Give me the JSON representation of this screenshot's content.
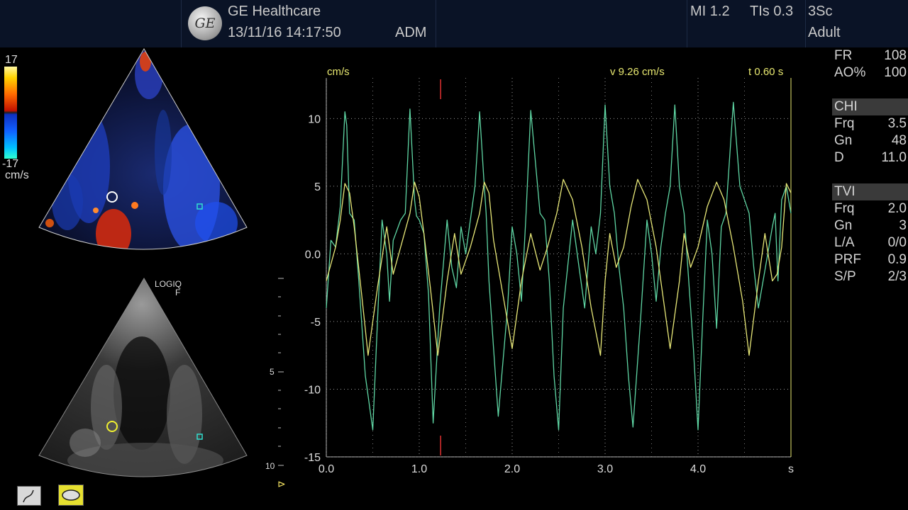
{
  "header": {
    "brand": "GE Healthcare",
    "datetime": "13/11/16 14:17:50",
    "operator": "ADM",
    "mi": "MI 1.2",
    "tis": "TIs 0.3",
    "probe": "3Sc",
    "preset": "Adult",
    "logo_icon": "ge-logo-icon"
  },
  "color_scale": {
    "max": "17",
    "min": "-17",
    "unit": "cm/s"
  },
  "bmode": {
    "device": "LOGIQ",
    "mark": "F",
    "depth_labels": [
      "5",
      "10"
    ]
  },
  "right_panel": {
    "fr": {
      "label": "FR",
      "value": "108"
    },
    "ao": {
      "label": "AO%",
      "value": "100"
    },
    "chi": {
      "title": "CHI",
      "items": [
        {
          "label": "Frq",
          "value": "3.5"
        },
        {
          "label": "Gn",
          "value": "48"
        },
        {
          "label": "D",
          "value": "11.0"
        }
      ]
    },
    "tvi": {
      "title": "TVI",
      "items": [
        {
          "label": "Frq",
          "value": "2.0"
        },
        {
          "label": "Gn",
          "value": "3"
        },
        {
          "label": "L/A",
          "value": "0/0"
        },
        {
          "label": "PRF",
          "value": "0.9"
        },
        {
          "label": "S/P",
          "value": "2/3"
        }
      ]
    }
  },
  "trace": {
    "unit_label": "cm/s",
    "velocity_readout": "v 9.26 cm/s",
    "time_readout": "t 0.60 s",
    "x_unit": "s",
    "cursor_time": 1.23
  },
  "chart_data": {
    "type": "line",
    "xlabel": "s",
    "ylabel": "cm/s",
    "xlim": [
      0,
      5.0
    ],
    "ylim": [
      -15,
      13
    ],
    "x_ticks": [
      "0.0",
      "1.0",
      "2.0",
      "3.0",
      "4.0"
    ],
    "y_ticks": [
      "10",
      "5",
      "0.0",
      "-5",
      "-10",
      "-15"
    ],
    "grid": true,
    "series": [
      {
        "color": "#5fd6a4",
        "x": [
          0,
          0.05,
          0.1,
          0.15,
          0.2,
          0.22,
          0.25,
          0.3,
          0.35,
          0.42,
          0.5,
          0.55,
          0.6,
          0.65,
          0.68,
          0.72,
          0.8,
          0.85,
          0.9,
          0.95,
          0.97,
          1.0,
          1.05,
          1.1,
          1.15,
          1.22,
          1.3,
          1.35,
          1.4,
          1.45,
          1.5,
          1.6,
          1.65,
          1.7,
          1.72,
          1.75,
          1.8,
          1.85,
          1.95,
          2.0,
          2.05,
          2.1,
          2.15,
          2.2,
          2.3,
          2.35,
          2.4,
          2.45,
          2.5,
          2.55,
          2.65,
          2.72,
          2.78,
          2.85,
          2.9,
          2.95,
          3.0,
          3.05,
          3.1,
          3.15,
          3.2,
          3.25,
          3.3,
          3.38,
          3.45,
          3.5,
          3.55,
          3.6,
          3.65,
          3.7,
          3.75,
          3.8,
          3.85,
          3.9,
          3.95,
          4.0,
          4.05,
          4.1,
          4.15,
          4.2,
          4.25,
          4.3,
          4.38,
          4.45,
          4.55,
          4.6,
          4.65,
          4.7,
          4.75,
          4.8,
          4.83,
          4.86,
          4.9,
          4.95,
          5.0
        ],
        "y": [
          -4,
          1,
          0.5,
          3.5,
          10.5,
          9.5,
          3,
          2.5,
          -2,
          -9,
          -13,
          -5,
          2.5,
          0,
          -3.5,
          1,
          2.5,
          3,
          10.7,
          4,
          2.8,
          2.5,
          1.5,
          -3,
          -12.5,
          -4,
          2.5,
          -1,
          -2.5,
          2,
          0,
          5,
          10.5,
          5,
          3,
          -2,
          -7,
          -12,
          -4,
          2,
          0,
          -3.5,
          3,
          10.6,
          3,
          2.5,
          -2,
          -9,
          -13,
          -4,
          2.5,
          -1,
          -4,
          2,
          0,
          3,
          11,
          5,
          3,
          -1,
          -4,
          -9,
          -12.8,
          -5,
          2.5,
          0,
          -3.5,
          0.5,
          3,
          5,
          11,
          5,
          3,
          -2,
          -7,
          -13,
          -5,
          2.5,
          0,
          -5.5,
          2,
          3,
          11.2,
          5,
          3,
          -1,
          -4,
          -2,
          0,
          2,
          3,
          -2,
          4,
          5,
          3
        ]
      },
      {
        "color": "#e8e878",
        "x": [
          0,
          0.1,
          0.15,
          0.2,
          0.25,
          0.3,
          0.38,
          0.45,
          0.55,
          0.65,
          0.72,
          0.8,
          0.9,
          0.95,
          1.0,
          1.05,
          1.12,
          1.2,
          1.3,
          1.38,
          1.45,
          1.55,
          1.65,
          1.7,
          1.75,
          1.8,
          1.9,
          2.0,
          2.1,
          2.2,
          2.3,
          2.38,
          2.48,
          2.55,
          2.65,
          2.75,
          2.85,
          2.95,
          3.0,
          3.05,
          3.12,
          3.2,
          3.28,
          3.35,
          3.45,
          3.55,
          3.62,
          3.7,
          3.8,
          3.85,
          3.92,
          4.0,
          4.1,
          4.2,
          4.28,
          4.38,
          4.48,
          4.55,
          4.65,
          4.72,
          4.8,
          4.85,
          4.9,
          4.95,
          5.0
        ],
        "y": [
          -2,
          0.5,
          2.5,
          5.2,
          4.5,
          2,
          -3,
          -7.5,
          -2.5,
          2,
          -1.5,
          0.5,
          3,
          5.3,
          4.2,
          1.5,
          -2.5,
          -7.5,
          -2,
          1.5,
          -1.5,
          0.5,
          3,
          5.3,
          4.5,
          1,
          -3,
          -7,
          -2,
          1.5,
          -1.2,
          0.5,
          3,
          5.5,
          4,
          0.5,
          -4,
          -7.5,
          -2,
          1.5,
          -1,
          0.5,
          3.5,
          5.5,
          4,
          0.5,
          -3,
          -7,
          -2,
          1.5,
          -1,
          0.5,
          3.5,
          5.3,
          4,
          0.5,
          -3.5,
          -7.5,
          -2,
          1.5,
          -2,
          -1.5,
          0.5,
          5.2,
          4.5
        ]
      }
    ]
  }
}
